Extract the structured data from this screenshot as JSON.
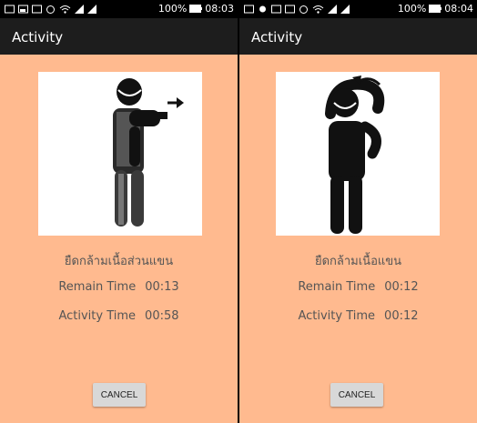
{
  "screens": [
    {
      "status": {
        "battery": "100%",
        "time": "08:03"
      },
      "appbar": {
        "title": "Activity"
      },
      "exercise": {
        "name": "ยืดกล้ามเนื้อส่วนแขน"
      },
      "remain": {
        "label": "Remain Time",
        "value": "00:13"
      },
      "activity": {
        "label": "Activity Time",
        "value": "00:58"
      },
      "cancel_label": "CANCEL"
    },
    {
      "status": {
        "battery": "100%",
        "time": "08:04"
      },
      "appbar": {
        "title": "Activity"
      },
      "exercise": {
        "name": "ยืดกล้ามเนื้อแขน"
      },
      "remain": {
        "label": "Remain Time",
        "value": "00:12"
      },
      "activity": {
        "label": "Activity Time",
        "value": "00:12"
      },
      "cancel_label": "CANCEL"
    }
  ]
}
